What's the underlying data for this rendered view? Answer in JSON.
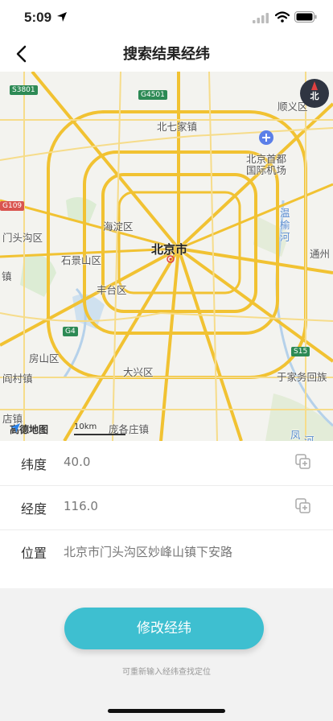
{
  "status": {
    "time": "5:09"
  },
  "header": {
    "title": "搜索结果经纬"
  },
  "map": {
    "city": "北京市",
    "labels": [
      "顺义区",
      "北七家镇",
      "北京首都",
      "国际机场",
      "温",
      "榆",
      "河",
      "门头沟区",
      "海淀区",
      "石景山区",
      "通州",
      "镇",
      "丰台区",
      "房山区",
      "阎村镇",
      "大兴区",
      "于家务回族",
      "店镇",
      "庞各庄镇",
      "凤",
      "河"
    ],
    "road_badges": [
      "S3801",
      "G4501",
      "G109",
      "G4",
      "S15"
    ],
    "compass": "北",
    "logo": "高德地图",
    "scale": "10km"
  },
  "info": {
    "rows": [
      {
        "label": "纬度",
        "value": "40.0"
      },
      {
        "label": "经度",
        "value": "116.0"
      },
      {
        "label": "位置",
        "value": "北京市门头沟区妙峰山镇下安路"
      }
    ]
  },
  "actions": {
    "edit_label": "修改经纬",
    "hint": "可重新输入经纬查找定位"
  }
}
